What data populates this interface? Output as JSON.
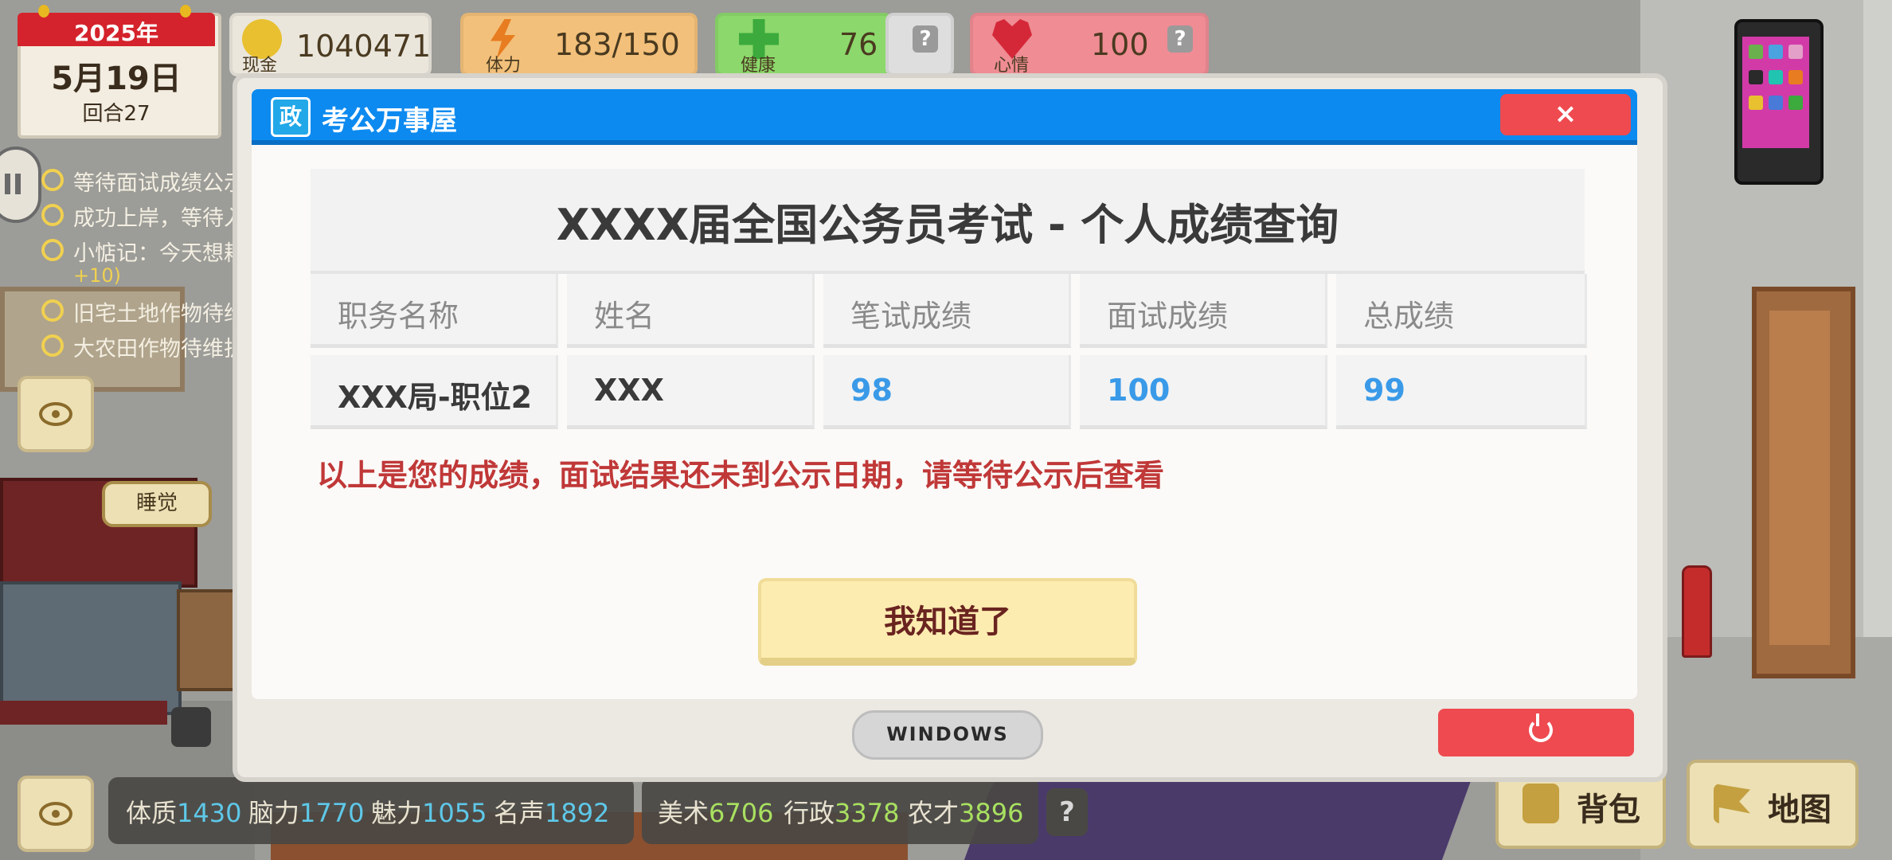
{
  "hud": {
    "year": "2025年",
    "date": "5月19日",
    "round": "回合27",
    "cash_label": "现金",
    "cash_value": "1040471",
    "stamina_label": "体力",
    "stamina_value": "183/150",
    "health_label": "健康",
    "health_value": "76",
    "mood_label": "心情",
    "mood_value": "100",
    "help_glyph": "?"
  },
  "tasks": [
    "等待面试成绩公示",
    "成功上岸，等待入职",
    "小惦记：今天想耕",
    "+10)",
    "旧宅土地作物待维",
    "大农田作物待维护"
  ],
  "sleep_label": "睡觉",
  "window": {
    "logo": "政",
    "title": "考公万事屋",
    "close": "×",
    "sheet_title": "XXXX届全国公务员考试 - 个人成绩查询",
    "columns": [
      "职务名称",
      "姓名",
      "笔试成绩",
      "面试成绩",
      "总成绩"
    ],
    "row": [
      "XXX局-职位2",
      "XXX",
      "98",
      "100",
      "99"
    ],
    "notice": "以上是您的成绩，面试结果还未到公示日期，请等待公示后查看",
    "ok": "我知道了",
    "os_label": "WINDOWS"
  },
  "attributes": {
    "a1_label": "体质",
    "a1_value": "1430",
    "a2_label": "脑力",
    "a2_value": "1770",
    "a3_label": "魅力",
    "a3_value": "1055",
    "a4_label": "名声",
    "a4_value": "1892",
    "b1_label": "美术",
    "b1_value": "6706",
    "b2_label": "行政",
    "b2_value": "3378",
    "b3_label": "农才",
    "b3_value": "3896",
    "help": "?"
  },
  "buttons": {
    "backpack": "背包",
    "map": "地图"
  },
  "colors": {
    "titlebar": "#0c8af0",
    "close": "#ee4a50",
    "notice": "#c03838",
    "score": "#3a9ae8",
    "ok_button": "#fdecb0"
  },
  "icons": [
    "coin-icon",
    "lightning-icon",
    "health-cross-icon",
    "heart-icon",
    "eye-icon",
    "pause-icon",
    "backpack-icon",
    "flag-icon",
    "power-icon",
    "phone-icon"
  ]
}
